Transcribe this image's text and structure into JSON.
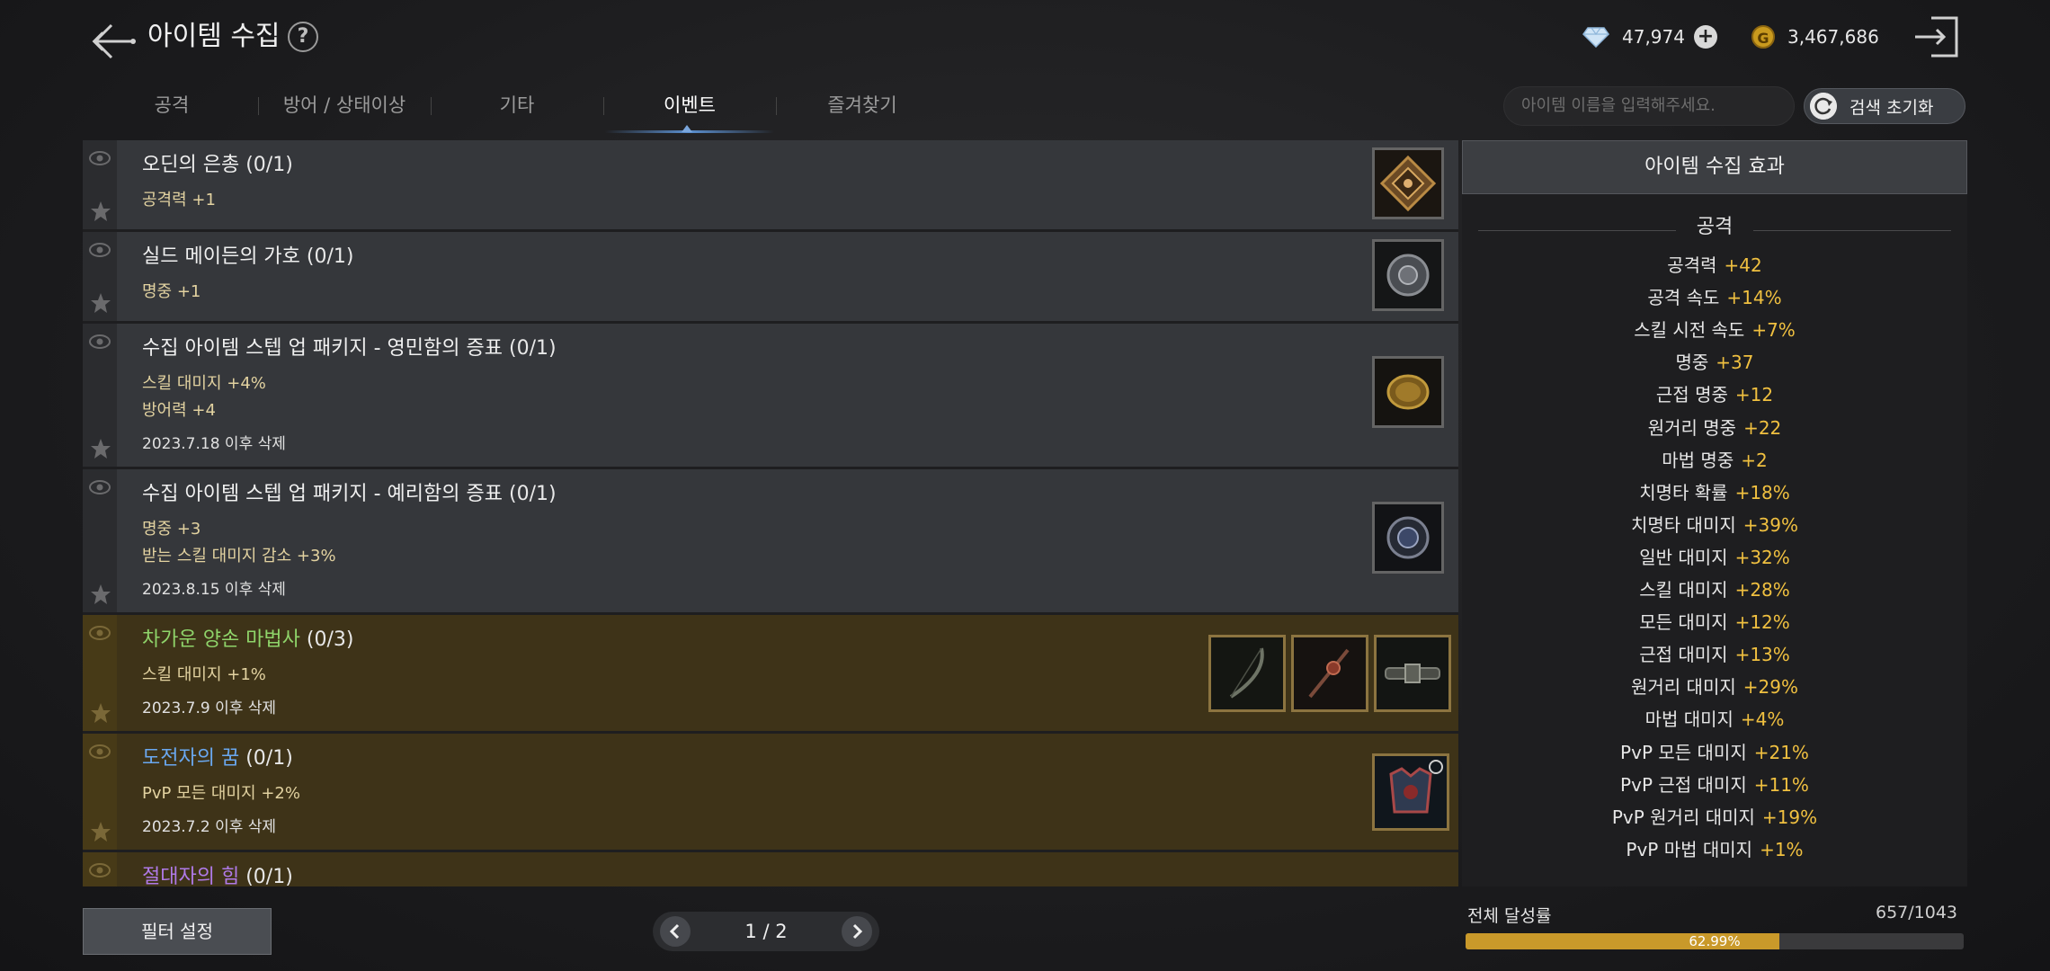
{
  "header": {
    "title": "아이템 수집",
    "diamond": "47,974",
    "gold": "3,467,686"
  },
  "tabs": [
    "공격",
    "방어 / 상태이상",
    "기타",
    "이벤트",
    "즐겨찾기"
  ],
  "active_tab": "이벤트",
  "search": {
    "placeholder": "아이템 이름을 입력해주세요.",
    "reset_label": "검색 초기화"
  },
  "collections": [
    {
      "name": "오딘의 은총",
      "count": "(0/1)",
      "stats": [
        "공격력 +1"
      ],
      "date": "",
      "name_color": "#f0f0f0"
    },
    {
      "name": "실드 메이든의 가호",
      "count": "(0/1)",
      "stats": [
        "명중 +1"
      ],
      "date": "",
      "name_color": "#f0f0f0"
    },
    {
      "name": "수집 아이템 스텝 업 패키지 - 영민함의 증표",
      "count": "(0/1)",
      "stats": [
        "스킬 대미지 +4%",
        "방어력 +4"
      ],
      "date": "2023.7.18 이후 삭제",
      "name_color": "#f0f0f0"
    },
    {
      "name": "수집 아이템 스텝 업 패키지 - 예리함의 증표",
      "count": "(0/1)",
      "stats": [
        "명중 +3",
        "받는 스킬 대미지 감소 +3%"
      ],
      "date": "2023.8.15 이후 삭제",
      "name_color": "#f0f0f0"
    },
    {
      "name": "차가운 양손 마법사",
      "count": "(0/3)",
      "stats": [
        "스킬 대미지 +1%"
      ],
      "date": "2023.7.9 이후 삭제",
      "name_color": "#8fd46a"
    },
    {
      "name": "도전자의 꿈",
      "count": "(0/1)",
      "stats": [
        "PvP 모든 대미지 +2%"
      ],
      "date": "2023.7.2 이후 삭제",
      "name_color": "#6aa8f0"
    },
    {
      "name": "절대자의 힘",
      "count": "(0/1)",
      "stats": [],
      "date": "",
      "name_color": "#b07ae8"
    }
  ],
  "effects": {
    "title": "아이템 수집 효과",
    "section": "공격",
    "items": [
      {
        "label": "공격력",
        "value": "+42"
      },
      {
        "label": "공격 속도",
        "value": "+14%"
      },
      {
        "label": "스킬 시전 속도",
        "value": "+7%"
      },
      {
        "label": "명중",
        "value": "+37"
      },
      {
        "label": "근접 명중",
        "value": "+12"
      },
      {
        "label": "원거리 명중",
        "value": "+22"
      },
      {
        "label": "마법 명중",
        "value": "+2"
      },
      {
        "label": "치명타 확률",
        "value": "+18%"
      },
      {
        "label": "치명타 대미지",
        "value": "+39%"
      },
      {
        "label": "일반 대미지",
        "value": "+32%"
      },
      {
        "label": "스킬 대미지",
        "value": "+28%"
      },
      {
        "label": "모든 대미지",
        "value": "+12%"
      },
      {
        "label": "근접 대미지",
        "value": "+13%"
      },
      {
        "label": "원거리 대미지",
        "value": "+29%"
      },
      {
        "label": "마법 대미지",
        "value": "+4%"
      },
      {
        "label": "PvP 모든 대미지",
        "value": "+21%"
      },
      {
        "label": "PvP 근접 대미지",
        "value": "+11%"
      },
      {
        "label": "PvP 원거리 대미지",
        "value": "+19%"
      },
      {
        "label": "PvP 마법 대미지",
        "value": "+1%"
      }
    ]
  },
  "footer": {
    "filter_label": "필터 설정",
    "page": "1 / 2",
    "progress_label": "전체 달성률",
    "progress_count": "657/1043",
    "progress_percent": "62.99%",
    "progress_fraction": 0.6299
  },
  "colors": {
    "accent_gold": "#f0c040",
    "event_row": "#3e3318",
    "normal_row": "#35373b",
    "tab_active_underline": "#5b8fcf"
  }
}
